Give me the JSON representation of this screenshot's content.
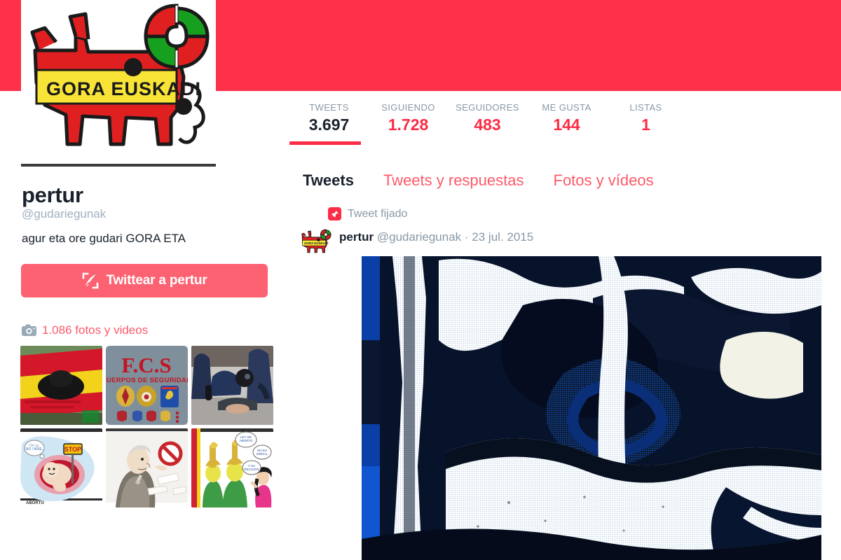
{
  "banner": {
    "color": "#ff3049"
  },
  "profile": {
    "name": "pertur",
    "handle": "@gudariegunak",
    "bio": "agur eta ore gudari GORA ETA",
    "avatar_icon": "gora-euskadi-bull-logo",
    "avatar_text": "GORA EUSKADI"
  },
  "tweet_button": {
    "label": "Twittear a pertur",
    "icon": "quill-compose-icon",
    "color": "#fc6272"
  },
  "photos": {
    "icon": "camera-icon",
    "count_label": "1.086 fotos y videos",
    "thumbnails": [
      {
        "name": "thumb-spanish-flag-tricorn"
      },
      {
        "name": "thumb-fcs-cuerpos-de-seguridad",
        "text": "F.C.S",
        "subtext": "CUERPOS DE SEGURIDAD"
      },
      {
        "name": "thumb-police-arrest-photo"
      },
      {
        "name": "thumb-aborto-cartoon",
        "text": "STOP",
        "subtext": "ABORTO"
      },
      {
        "name": "thumb-bishop-cartoon"
      },
      {
        "name": "thumb-bishops-woman-cartoon"
      }
    ]
  },
  "stats": [
    {
      "label": "TWEETS",
      "value": "3.697",
      "active": true
    },
    {
      "label": "SIGUIENDO",
      "value": "1.728",
      "active": false
    },
    {
      "label": "SEGUIDORES",
      "value": "483",
      "active": false
    },
    {
      "label": "ME GUSTA",
      "value": "144",
      "active": false
    },
    {
      "label": "LISTAS",
      "value": "1",
      "active": false
    }
  ],
  "tabs": [
    {
      "label": "Tweets",
      "active": true
    },
    {
      "label": "Tweets y respuestas",
      "active": false
    },
    {
      "label": "Fotos y vídeos",
      "active": false
    }
  ],
  "tweet": {
    "pinned_label": "Tweet fijado",
    "pin_icon": "pin-icon",
    "author": "pertur",
    "handle": "@gudariegunak",
    "separator": "·",
    "date": "23 jul. 2015",
    "media_alt": "halftone-blue-snake-axe-emblem"
  },
  "colors": {
    "accent_red": "#fc2c46",
    "link_red": "#fc5a6a",
    "gray_text": "#8899a6",
    "dark_text": "#19222c"
  }
}
